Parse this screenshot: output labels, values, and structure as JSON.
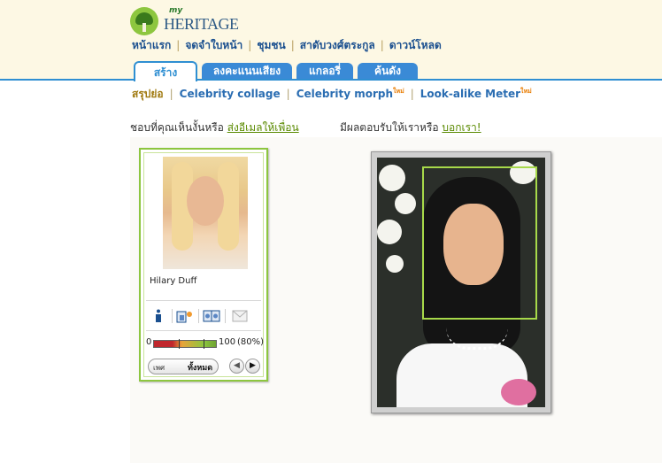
{
  "logo": {
    "prefix": "my",
    "name": "HERITAGE"
  },
  "top_nav": [
    "หน้าแรก",
    "จดจำใบหน้า",
    "ชุมชน",
    "สาดับวงศ์ตระกูล",
    "ดาวน์โหลด"
  ],
  "tabs": [
    "สร้าง",
    "ลงคะแนนเสียง",
    "แกลอรี่",
    "ค้นดัง"
  ],
  "sub_nav": {
    "items": [
      "สรุปย่อ",
      "Celebrity collage",
      "Celebrity morph",
      "Look-alike Meter"
    ],
    "new_badge": "ใหม่"
  },
  "info": {
    "left_text": "ชอบที่คุณเห็นงั้นหรือ",
    "left_link": "ส่งอีเมลให้เพื่อน",
    "right_text": "มีผลตอบรับให้เราหรือ",
    "right_link": "บอกเรา!"
  },
  "match_card": {
    "celebrity_name": "Hilary Duff",
    "meter": {
      "min": "0",
      "max": "100",
      "percent_label": "(80%)",
      "value": 0.8
    },
    "filter": {
      "label": "เพศ",
      "value": "ทั้งหมด"
    },
    "tools": [
      "info-icon",
      "morph-icon",
      "compare-icon",
      "email-icon"
    ]
  },
  "colors": {
    "accent_blue": "#2f8fd2",
    "accent_green": "#8dc63f",
    "header_bg": "#fdf8e4"
  }
}
